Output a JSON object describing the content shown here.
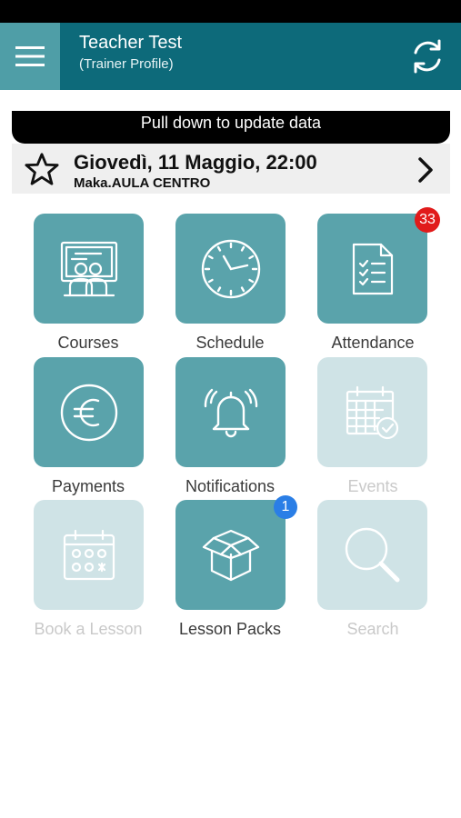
{
  "header": {
    "title": "Teacher Test",
    "subtitle": "(Trainer Profile)",
    "menu_icon": "hamburger-menu-icon",
    "refresh_icon": "refresh-icon"
  },
  "banner": {
    "text": "Pull down to update data"
  },
  "next_event": {
    "date_time": "Giovedì, 11 Maggio, 22:00",
    "place": "Maka.AULA CENTRO"
  },
  "tiles": {
    "courses": {
      "label": "Courses",
      "icon": "classroom-icon"
    },
    "schedule": {
      "label": "Schedule",
      "icon": "clock-icon"
    },
    "attendance": {
      "label": "Attendance",
      "icon": "checklist-icon",
      "badge": "33"
    },
    "payments": {
      "label": "Payments",
      "icon": "euro-icon"
    },
    "notifications": {
      "label": "Notifications",
      "icon": "bell-icon"
    },
    "events": {
      "label": "Events",
      "icon": "calendar-check-icon"
    },
    "book_lesson": {
      "label": "Book a Lesson",
      "icon": "calendar-icon"
    },
    "lesson_packs": {
      "label": "Lesson Packs",
      "icon": "box-icon",
      "badge": "1"
    },
    "search": {
      "label": "Search",
      "icon": "search-icon"
    }
  },
  "colors": {
    "header_bg": "#0d6a7a",
    "tile_active": "#5aa3ab",
    "tile_disabled": "#cfe3e6",
    "badge_red": "#e11b1b",
    "badge_blue": "#2a7ee6"
  }
}
